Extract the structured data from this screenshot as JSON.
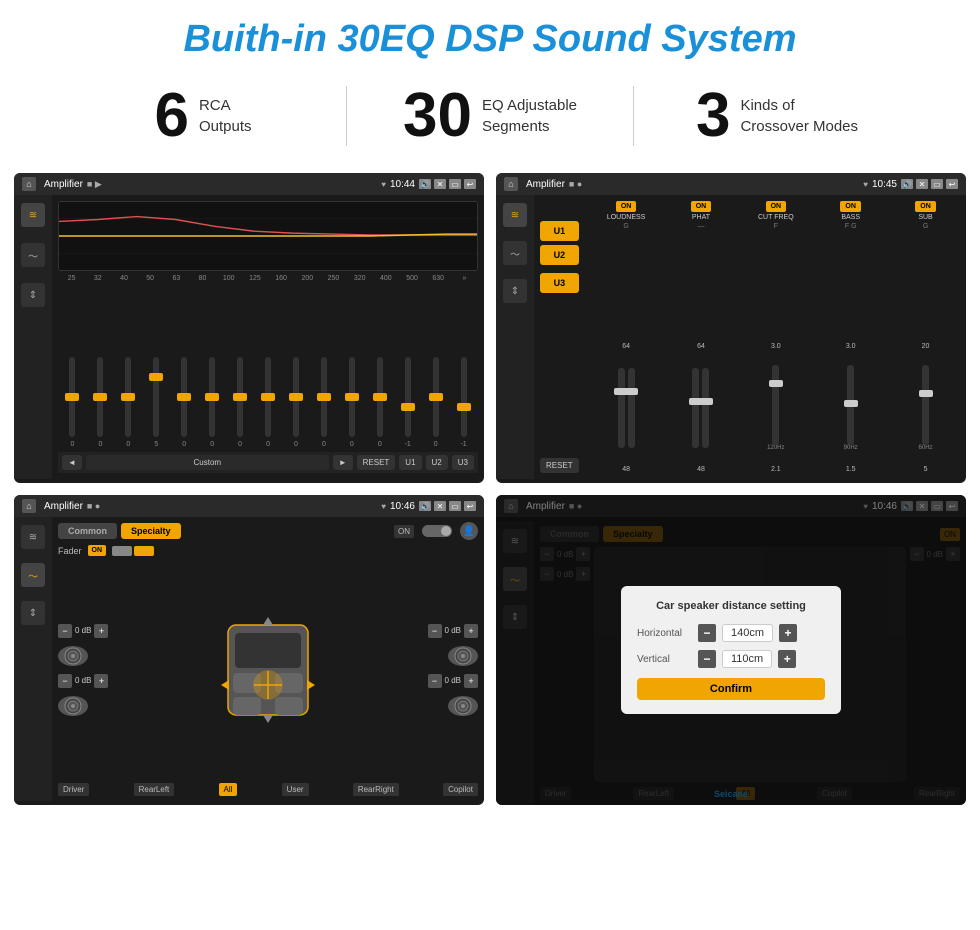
{
  "header": {
    "title": "Buith-in 30EQ DSP Sound System"
  },
  "stats": [
    {
      "number": "6",
      "label": "RCA\nOutputs"
    },
    {
      "number": "30",
      "label": "EQ Adjustable\nSegments"
    },
    {
      "number": "3",
      "label": "Kinds of\nCrossover Modes"
    }
  ],
  "screens": {
    "screen1": {
      "statusBar": {
        "title": "Amplifier",
        "time": "10:44"
      },
      "frequencies": [
        "25",
        "32",
        "40",
        "50",
        "63",
        "80",
        "100",
        "125",
        "160",
        "200",
        "250",
        "320",
        "400",
        "500",
        "630"
      ],
      "values": [
        "0",
        "0",
        "0",
        "5",
        "0",
        "0",
        "0",
        "0",
        "0",
        "0",
        "0",
        "0",
        "-1",
        "0",
        "-1"
      ],
      "buttons": [
        "◄",
        "Custom",
        "►",
        "RESET",
        "U1",
        "U2",
        "U3"
      ]
    },
    "screen2": {
      "statusBar": {
        "title": "Amplifier",
        "time": "10:45"
      },
      "uButtons": [
        "U1",
        "U2",
        "U3"
      ],
      "channels": [
        "LOUDNESS",
        "PHAT",
        "CUT FREQ",
        "BASS",
        "SUB"
      ],
      "onLabels": [
        "ON",
        "ON",
        "ON",
        "ON",
        "ON"
      ],
      "resetBtn": "RESET"
    },
    "screen3": {
      "statusBar": {
        "title": "Amplifier",
        "time": "10:46"
      },
      "tabs": [
        "Common",
        "Specialty"
      ],
      "faderLabel": "Fader",
      "faderOn": "ON",
      "dbValues": [
        "0 dB",
        "0 dB",
        "0 dB",
        "0 dB"
      ],
      "bottomButtons": [
        "Driver",
        "RearLeft",
        "All",
        "User",
        "RearRight",
        "Copilot"
      ]
    },
    "screen4": {
      "statusBar": {
        "title": "Amplifier",
        "time": "10:46"
      },
      "tabs": [
        "Common",
        "Specialty"
      ],
      "dialog": {
        "title": "Car speaker distance setting",
        "horizontal": {
          "label": "Horizontal",
          "value": "140cm"
        },
        "vertical": {
          "label": "Vertical",
          "value": "110cm"
        },
        "confirmLabel": "Confirm"
      },
      "dbValues": [
        "0 dB",
        "0 dB"
      ],
      "bottomButtons": [
        "Driver",
        "RearLeft",
        "Copilot",
        "RearRight"
      ]
    }
  },
  "watermark": "Seicane"
}
